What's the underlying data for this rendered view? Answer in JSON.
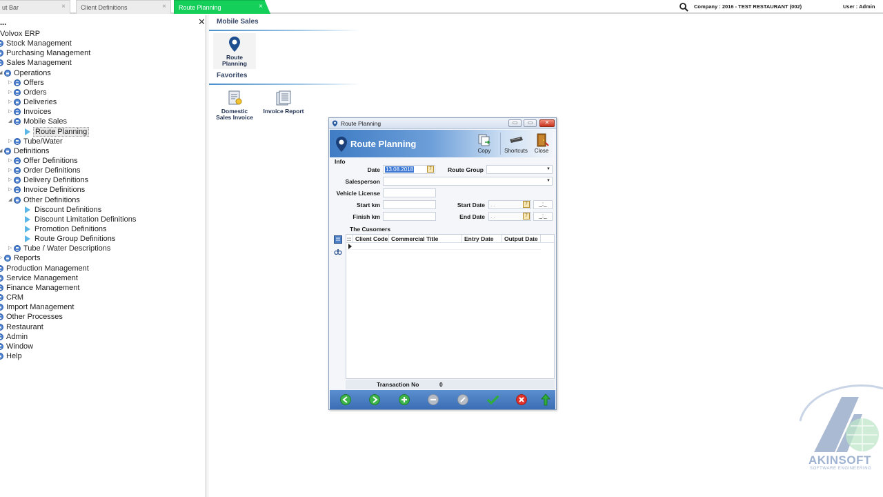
{
  "tabs": [
    {
      "label": "ut Bar",
      "close": "×"
    },
    {
      "label": "Client Definitions",
      "close": "×"
    },
    {
      "label": "Route Planning",
      "close": "×"
    }
  ],
  "topbar": {
    "company": "Company : 2016 - TEST RESTAURANT (002)",
    "user": "User : Admin"
  },
  "tree": {
    "title": "...",
    "close": "✕",
    "items": [
      {
        "label": "Volvox ERP"
      },
      {
        "label": "Stock Management"
      },
      {
        "label": "Purchasing Management"
      },
      {
        "label": "Sales Management"
      },
      {
        "label": "Operations"
      },
      {
        "label": "Offers"
      },
      {
        "label": "Orders"
      },
      {
        "label": "Deliveries"
      },
      {
        "label": "Invoices"
      },
      {
        "label": "Mobile Sales"
      },
      {
        "label": "Route Planning"
      },
      {
        "label": "Tube/Water"
      },
      {
        "label": "Definitions"
      },
      {
        "label": "Offer Definitions"
      },
      {
        "label": "Order Definitions"
      },
      {
        "label": "Delivery Definitions"
      },
      {
        "label": "Invoice Definitions"
      },
      {
        "label": "Other Definitions"
      },
      {
        "label": "Discount Definitions"
      },
      {
        "label": "Discount Limitation Definitions"
      },
      {
        "label": "Promotion Definitions"
      },
      {
        "label": "Route Group Definitions"
      },
      {
        "label": "Tube / Water Descriptions"
      },
      {
        "label": "Reports"
      },
      {
        "label": "Production Management"
      },
      {
        "label": "Service Management"
      },
      {
        "label": "Finance Management"
      },
      {
        "label": "CRM"
      },
      {
        "label": "Import Management"
      },
      {
        "label": "Other Processes"
      },
      {
        "label": "Restaurant"
      },
      {
        "label": "Admin"
      },
      {
        "label": "Window"
      },
      {
        "label": "Help"
      }
    ]
  },
  "main": {
    "mobile_sales_title": "Mobile Sales",
    "favorites_title": "Favorites",
    "tiles": {
      "route_planning": [
        "Route",
        "Planning"
      ],
      "domestic_sales_invoice": [
        "Domestic",
        "Sales Invoice"
      ],
      "invoice_report": [
        "Invoice Report"
      ]
    }
  },
  "dialog": {
    "window_title": "Route Planning",
    "header_title": "Route Planning",
    "buttons": {
      "copy": "Copy",
      "shortcuts": "Shortcuts",
      "close": "Close"
    },
    "win_controls": {
      "minimize": "▭",
      "maximize": "▭",
      "close": "✕"
    },
    "info_label": "Info",
    "fields": {
      "date_label": "Date",
      "date_value": "13.08.2018",
      "route_group_label": "Route Group",
      "salesperson_label": "Salesperson",
      "vehicle_license_label": "Vehicle License",
      "start_km_label": "Start km",
      "finish_km_label": "Finish km",
      "start_date_label": "Start Date",
      "end_date_label": "End Date",
      "date_placeholder": ". .",
      "time_placeholder": "_:_"
    },
    "customers_title": "The Cusomers",
    "grid_columns": [
      "Client Code",
      "Commercial Title",
      "Entry Date",
      "Output Date"
    ],
    "transaction_no_label": "Transaction No",
    "transaction_no_value": "0"
  },
  "logo": {
    "name": "AKINSOFT",
    "tagline": "SOFTWARE ENGINEERING"
  },
  "colors": {
    "active_tab": "#14d05a",
    "dialog_header": "#3f7cc4",
    "navbar": "#3a6db4"
  }
}
